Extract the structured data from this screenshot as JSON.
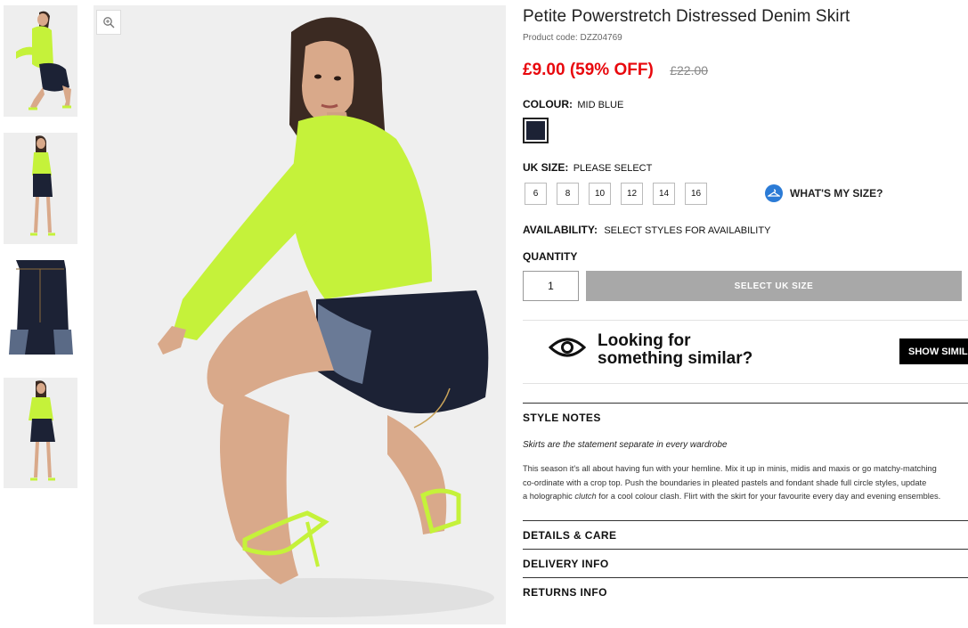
{
  "product": {
    "title": "Petite Powerstretch Distressed Denim Skirt",
    "code": "Product code: DZZ04769",
    "price": "£9.00 (59% OFF)",
    "was_price": "£22.00"
  },
  "colour": {
    "label": "COLOUR:",
    "value": "MID BLUE",
    "swatch_color": "#1c2235"
  },
  "size": {
    "label": "UK SIZE:",
    "value": "PLEASE SELECT",
    "options": [
      "6",
      "8",
      "10",
      "12",
      "14",
      "16"
    ],
    "whats_my_size": "WHAT'S MY SIZE?",
    "icon": "hanger-icon"
  },
  "availability": {
    "label": "AVAILABILITY:",
    "value": "SELECT STYLES FOR AVAILABILITY"
  },
  "quantity": {
    "label": "QUANTITY",
    "value": "1",
    "button": "SELECT UK SIZE"
  },
  "similar": {
    "line1": "Looking for",
    "line2": "something similar?",
    "button": "SHOW SIMILAR",
    "icon": "eye-icon"
  },
  "style_notes": {
    "title": "STYLE NOTES",
    "tagline": "Skirts are the statement separate in every wardrobe",
    "desc_lines": [
      "This season it's all about having fun with your hemline. Mix it up in minis, midis and maxis or go matchy-matching",
      "co-ordinate with a crop top. Push the boundaries in pleated pastels and fondant shade full circle styles, update",
      "a holographic |clutch| for a cool colour clash. Flirt with the skirt for your favourite every day and evening ensembles."
    ]
  },
  "accordions": [
    "DETAILS & CARE",
    "DELIVERY INFO",
    "RETURNS INFO"
  ],
  "colors": {
    "sale_red": "#e8080d",
    "neon_green": "#c5f23a",
    "denim": "#1c2235",
    "disabled_button": "#a8a8a8",
    "accent_blue": "#2b7bd6"
  }
}
